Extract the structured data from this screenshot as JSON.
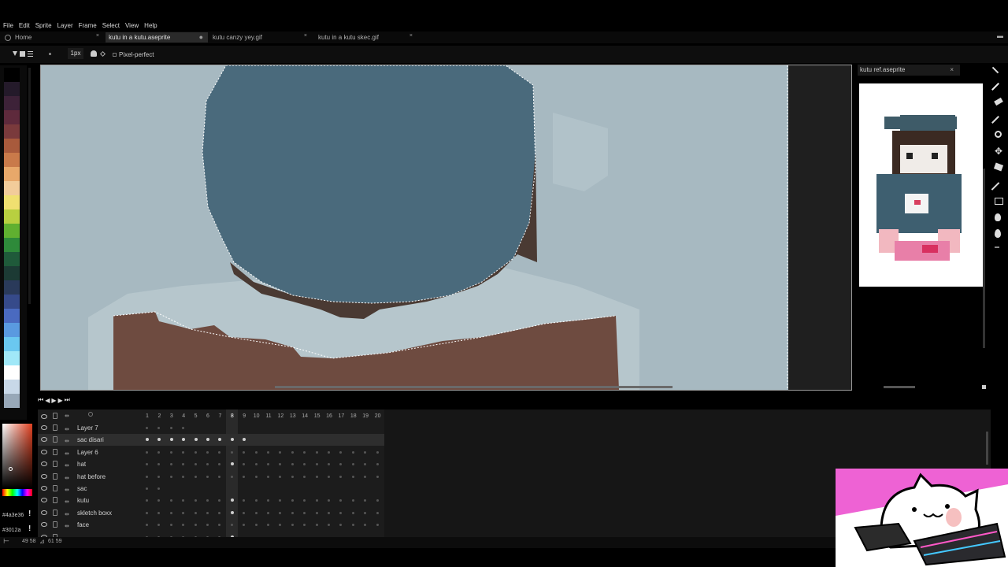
{
  "menu": [
    "File",
    "Edit",
    "Sprite",
    "Layer",
    "Frame",
    "Select",
    "View",
    "Help"
  ],
  "tabs": [
    {
      "label": "Home",
      "active": false,
      "closable": false
    },
    {
      "label": "kutu in a kutu.aseprite",
      "active": true,
      "closable": true
    },
    {
      "label": "kutu canzy yey.gif",
      "active": false,
      "closable": true
    },
    {
      "label": "kutu in a kutu skec.gif",
      "active": false,
      "closable": true
    }
  ],
  "tab_close_glyph": "×",
  "toolbar": {
    "brush_size": "1px",
    "pixel_perfect_label": "Pixel-perfect",
    "pixel_perfect_checked": false
  },
  "palette": [
    "#000000",
    "#241a2a",
    "#3d2238",
    "#5e2a3c",
    "#7a3a3c",
    "#a85a3c",
    "#c97a4a",
    "#e8a86a",
    "#f2cc9a",
    "#f0e070",
    "#b8d040",
    "#60b030",
    "#2e8a3a",
    "#1f5a3a",
    "#1c3a34",
    "#2a3a5a",
    "#364a8a",
    "#4a6ac0",
    "#5a9ae0",
    "#6ac8f0",
    "#a0e8f8",
    "#ffffff",
    "#c8d8e8",
    "#98a8b8"
  ],
  "color_fg_hex": "#4a3e36",
  "color_bg_hex": "#3012a",
  "reference": {
    "title": "kutu ref.aseprite",
    "close_glyph": "×"
  },
  "animation_controls": [
    "⏮",
    "◀",
    "▶",
    "▶",
    "⏭"
  ],
  "timeline": {
    "frames": [
      "1",
      "2",
      "3",
      "4",
      "5",
      "6",
      "7",
      "8",
      "9",
      "10",
      "11",
      "12",
      "13",
      "14",
      "15",
      "16",
      "17",
      "18",
      "19",
      "20"
    ],
    "current_frame": 8,
    "layers": [
      {
        "name": "Layer 7",
        "selected": false
      },
      {
        "name": "sac disari",
        "selected": true
      },
      {
        "name": "Layer 6",
        "selected": false
      },
      {
        "name": "hat",
        "selected": false
      },
      {
        "name": "hat before",
        "selected": false
      },
      {
        "name": "sac",
        "selected": false
      },
      {
        "name": "kutu",
        "selected": false
      },
      {
        "name": "skletch boxx",
        "selected": false
      },
      {
        "name": "face",
        "selected": false
      },
      {
        "name": "...",
        "selected": false
      }
    ]
  },
  "status": {
    "pos": "49 58",
    "size": "61 59"
  },
  "icons": [
    "file-icon",
    "save-icon",
    "hamburger-icon",
    "bucket-icon",
    "pencil-icon",
    "eraser-icon",
    "eyedropper-icon",
    "zoom-icon",
    "move-icon",
    "fill-icon",
    "line-icon",
    "rect-icon",
    "blur-icon",
    "ink-icon",
    "warning-icon"
  ]
}
